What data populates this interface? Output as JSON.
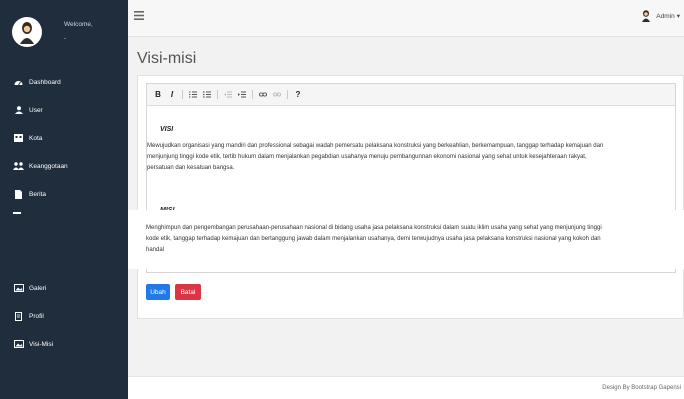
{
  "sidebar": {
    "welcome": "Welcome,",
    "user_name": "-",
    "items": [
      {
        "label": "Dashboard",
        "icon": "dashboard-icon"
      },
      {
        "label": "User",
        "icon": "user-icon"
      },
      {
        "label": "Kota",
        "icon": "city-icon"
      },
      {
        "label": "Keanggotaan",
        "icon": "members-icon"
      },
      {
        "label": "Berita",
        "icon": "file-icon"
      },
      {
        "label": "Galeri",
        "icon": "image-icon"
      },
      {
        "label": "Profil",
        "icon": "document-icon"
      },
      {
        "label": "Visi-Misi",
        "icon": "image-icon"
      }
    ]
  },
  "topbar": {
    "admin_label": "Admin"
  },
  "page": {
    "title": "Visi-misi"
  },
  "editor": {
    "toolbar": [
      "B",
      "I",
      "ordered-list",
      "unordered-list",
      "outdent",
      "indent",
      "link",
      "unlink",
      "?"
    ],
    "visi_heading": "VISI",
    "visi_line1": "Mewujudkan organisasi yang mandiri dan professional sebagai wadah pemersatu pelaksana konstruksi yang berkeahlian, berkemampuan, tanggap terhadap kemajuan dan",
    "visi_line2": "menjunjung tinggi kode etik, tertib hukum dalam menjalankan pegabdian usahanya menuju pembangunnan ekonomi nasional yang sehat untuk kesejahteraan rakyat,",
    "visi_line3": "persatuan dan kesatuan bangsa.",
    "misi_heading": "MISI",
    "misi_line1": "Menghimpun dan pengembangan perusahaan-perusahaan nasional di bidang usaha jasa pelaksana konstruksi dalam suatu iklim usaha yang sehat yang menjunjung tinggi",
    "misi_line2": "kode etik, tanggap terhadap kemajuan dan bertanggung jawab dalam menjalankan usahanya, demi terwujudnya usaha jasa pelaksana konstruksi nasional yang kokoh dan",
    "misi_line3": "handal"
  },
  "buttons": {
    "ubah": "Ubah",
    "batal": "Batal"
  },
  "footer": {
    "text": "Design By Bootstrap Gapensi"
  },
  "colors": {
    "sidebar": "#1f2d3d",
    "primary": "#1f7ae8",
    "danger": "#dc3545"
  }
}
